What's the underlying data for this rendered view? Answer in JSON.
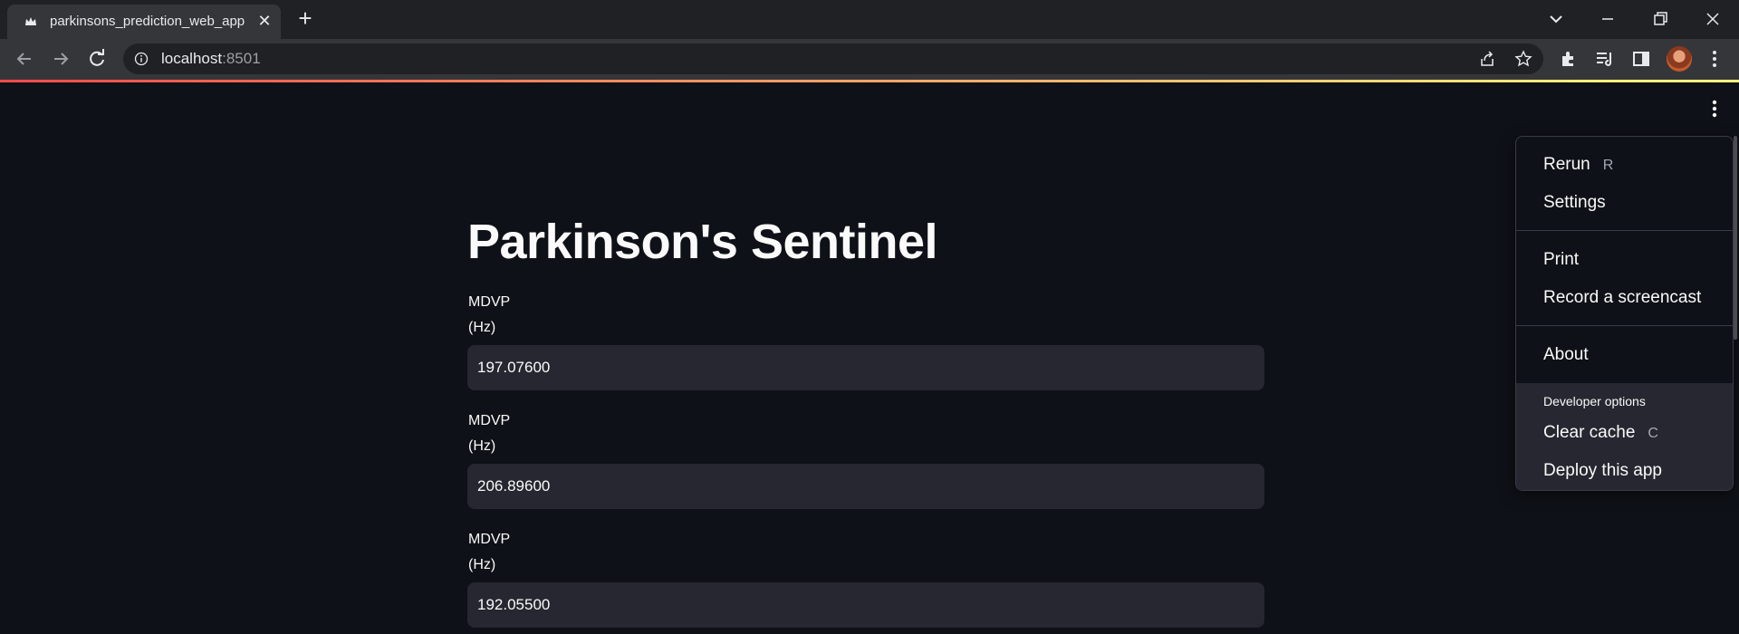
{
  "browser": {
    "tab_title": "parkinsons_prediction_web_app",
    "url_host": "localhost",
    "url_port": ":8501"
  },
  "app": {
    "title": "Parkinson's Sentinel",
    "fields": [
      {
        "label_line1": "MDVP",
        "label_line2": "(Hz)",
        "value": "197.07600"
      },
      {
        "label_line1": "MDVP",
        "label_line2": "(Hz)",
        "value": "206.89600"
      },
      {
        "label_line1": "MDVP",
        "label_line2": "(Hz)",
        "value": "192.05500"
      }
    ]
  },
  "menu": {
    "rerun": "Rerun",
    "rerun_shortcut": "R",
    "settings": "Settings",
    "print": "Print",
    "record": "Record a screencast",
    "about": "About",
    "developer_options": "Developer options",
    "clear_cache": "Clear cache",
    "clear_cache_shortcut": "C",
    "deploy": "Deploy this app"
  },
  "colors": {
    "background": "#0e1117",
    "input_bg": "#262730",
    "accent_start": "#ff4b4b",
    "accent_end": "#fffd80"
  }
}
